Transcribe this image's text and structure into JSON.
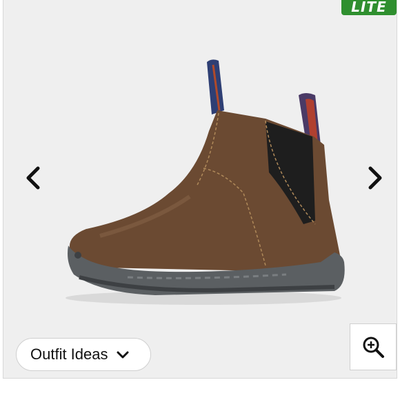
{
  "badge": {
    "text": "LITE"
  },
  "outfit_button": {
    "label": "Outfit Ideas"
  },
  "icons": {
    "prev": "chevron-left-icon",
    "next": "chevron-right-icon",
    "dropdown": "chevron-down-icon",
    "zoom": "zoom-in-icon"
  },
  "colors": {
    "viewer_background": "#efefef",
    "badge_green": "#2f8f2f",
    "boot_brown": "#6b4a32",
    "sole_gray": "#5b5f62"
  }
}
